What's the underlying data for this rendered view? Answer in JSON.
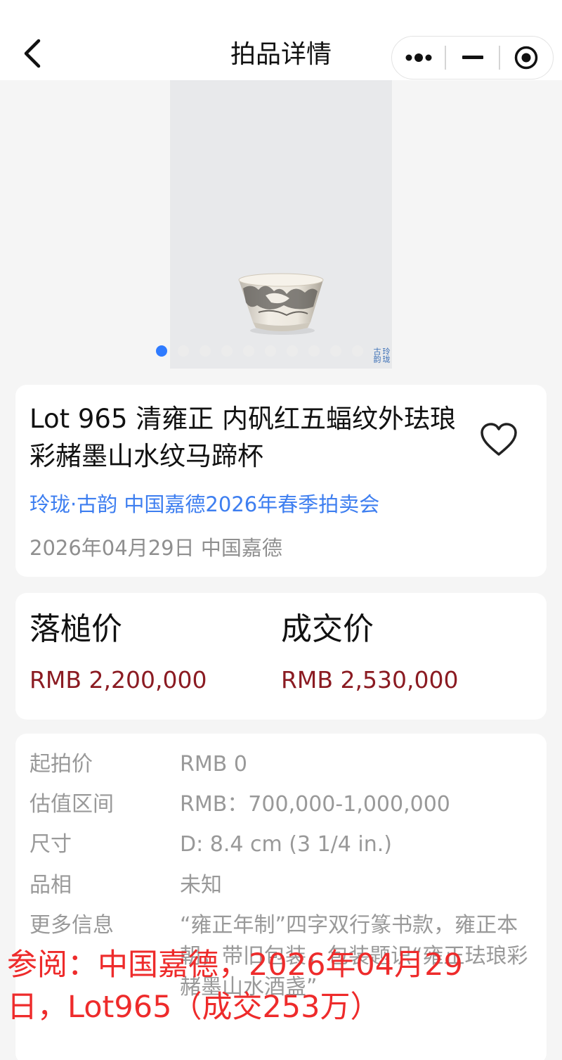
{
  "nav": {
    "title": "拍品详情"
  },
  "gallery": {
    "seal_text": "玲珑 古韵",
    "dot_count": 10,
    "active_index": 0
  },
  "lot": {
    "title": "Lot 965 清雍正 内矾红五蝠纹外珐琅彩赭墨山水纹马蹄杯",
    "sale_link": "玲珑·古韵 中国嘉德2026年春季拍卖会",
    "sale_meta": "2026年04月29日 中国嘉德"
  },
  "prices": {
    "hammer_label": "落槌价",
    "hammer_value": "RMB 2,200,000",
    "deal_label": "成交价",
    "deal_value": "RMB 2,530,000"
  },
  "details": [
    {
      "label": "起拍价",
      "value": "RMB 0"
    },
    {
      "label": "估值区间",
      "value": "RMB：700,000-1,000,000"
    },
    {
      "label": "尺寸",
      "value": "D: 8.4 cm (3 1/4 in.)"
    },
    {
      "label": "品相",
      "value": "未知"
    },
    {
      "label": "更多信息",
      "value": "“雍正年制”四字双行篆书款，雍正本朝，带旧包装，包装题识“雍正珐琅彩赭墨山水酒盏”"
    }
  ],
  "watermark": "参阅：中国嘉德，2026年04月29日，Lot965（成交253万）",
  "colors": {
    "link_blue": "#3d7ef0",
    "price_red": "#8b1b22",
    "dot_active": "#2f7bff",
    "watermark_red": "#ee2b2b"
  },
  "icons": [
    "back-chevron-icon",
    "more-dots-icon",
    "minimize-icon",
    "close-target-icon",
    "heart-outline-icon"
  ]
}
